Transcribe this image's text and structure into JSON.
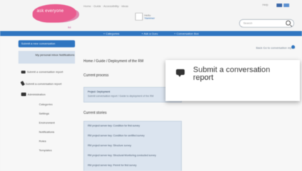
{
  "header": {
    "logo_text": "ask everyone",
    "logo_sub": "ltd",
    "top_links": "Home · Guide · Accessibility · Ideas",
    "user_line1": "Hello",
    "user_name": "Yammer",
    "top_right": "Help",
    "search_placeholder": "Search"
  },
  "navbar": {
    "items": [
      "+ Categories",
      "+ Ask a Guru",
      "+ Conversation Box"
    ]
  },
  "sidebar": {
    "header": "Submit a new conversation",
    "selected": "My personal inbox Notifications",
    "items": [
      "Submit a conversation report",
      "Submit a conversation report",
      "Administration"
    ],
    "subitems": [
      "Categories",
      "Settings",
      "Environment",
      "Notifications",
      "Roles",
      "Templates"
    ]
  },
  "main": {
    "right_link": "Back Go to conversation report",
    "breadcrumb": "Home / Guide / Deployment of the RM",
    "current_process_title": "Current process",
    "process_line1": "Project: Deployment",
    "process_line2": "Submit conversation report / Guide to deployment of the RM",
    "current_stories_title": "Current stories",
    "stories": [
      "RM project server key: Condition for first survey",
      "RM project server key: Condition for certified survey",
      "RM project server key: Structure survey",
      "RM project server key: Structural Monitoring conducted survey",
      "RM project server key: Permit for first survey"
    ]
  },
  "popup": {
    "icon": "speech-bubble-icon",
    "text": "Submit a conversation report"
  },
  "colors": {
    "brand": "#e95c8f",
    "nav_blue": "#2f75c0",
    "panel_blue": "#dbe4ef"
  }
}
